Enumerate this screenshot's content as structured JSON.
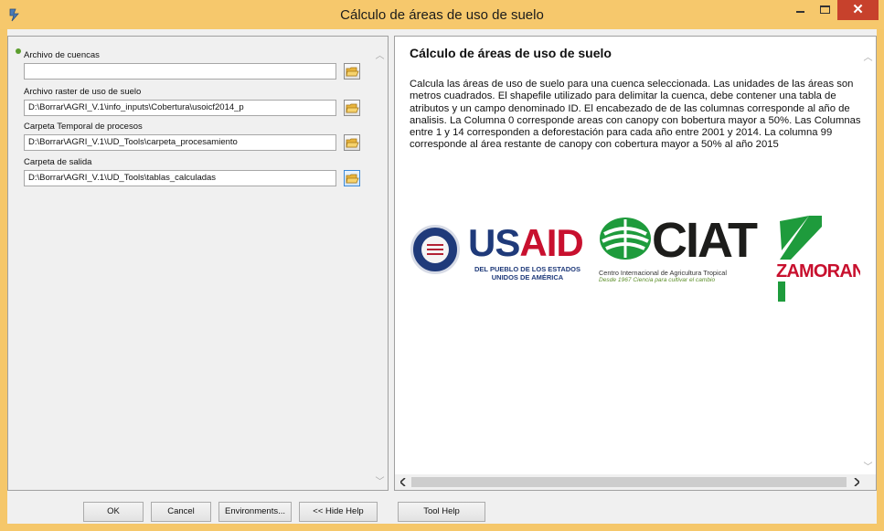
{
  "window": {
    "title": "Cálculo de áreas de uso de suelo",
    "close_glyph": "✕"
  },
  "params": [
    {
      "label": "Archivo de cuencas",
      "value": "",
      "required": true
    },
    {
      "label": "Archivo raster de uso de suelo",
      "value": "D:\\Borrar\\AGRI_V.1\\info_inputs\\Cobertura\\usoicf2014_p",
      "required": false
    },
    {
      "label": "Carpeta Temporal de procesos",
      "value": "D:\\Borrar\\AGRI_V.1\\UD_Tools\\carpeta_procesamiento",
      "required": false
    },
    {
      "label": "Carpeta de salida",
      "value": "D:\\Borrar\\AGRI_V.1\\UD_Tools\\tablas_calculadas",
      "required": false
    }
  ],
  "help": {
    "title": "Cálculo de áreas de uso de suelo",
    "body": "Calcula las áreas de uso de suelo para una cuenca seleccionada. Las unidades de las áreas son metros cuadrados. El shapefile utilizado para delimitar la cuenca, debe contener una tabla de atributos y un campo denominado ID. El encabezado de de las columnas corresponde al año de analisis. La Columna 0 corresponde areas con canopy con bobertura mayor a 50%. Las Columnas entre 1 y 14 corresponden a deforestación para cada año entre 2001 y 2014. La columna 99 corresponde al área restante de canopy con cobertura mayor a 50% al año 2015"
  },
  "logos": {
    "usaid": {
      "word_us": "US",
      "word_aid": "AID",
      "subtitle": "DEL PUEBLO DE LOS ESTADOS UNIDOS DE AMÉRICA",
      "brand_blue": "#1f3a7a",
      "brand_red": "#c8102e"
    },
    "ciat": {
      "word": "CIAT",
      "subtitle": "Centro Internacional de Agricultura Tropical",
      "tagline": "Desde 1967 Ciencia para cultivar el cambio",
      "brand_green": "#1e9b3c"
    },
    "zamorano": {
      "word": "ZAMORANO",
      "brand_red": "#c8102e",
      "brand_green": "#1e9b3c"
    }
  },
  "buttons": {
    "ok": "OK",
    "cancel": "Cancel",
    "environments": "Environments...",
    "hide_help": "<< Hide Help",
    "tool_help": "Tool Help"
  },
  "colors": {
    "title_bar": "#f6c86c",
    "close_button": "#c7412c",
    "required_dot": "#5c9e2e"
  }
}
